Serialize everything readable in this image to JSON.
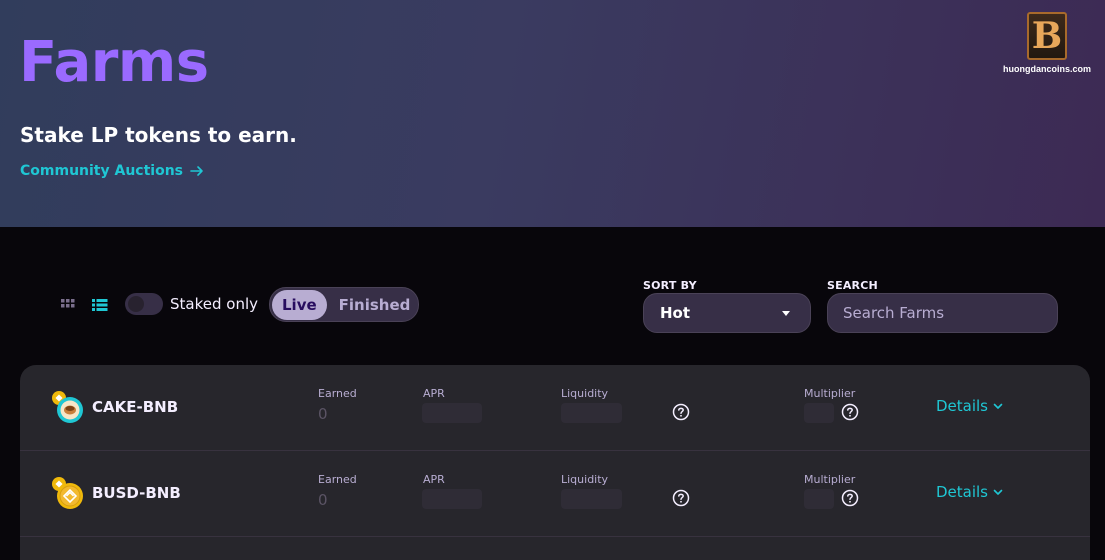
{
  "hero": {
    "title": "Farms",
    "subtitle": "Stake LP tokens to earn.",
    "link_label": "Community Auctions"
  },
  "watermark": {
    "logo_letter": "B",
    "site": "huongdancoins.com"
  },
  "controls": {
    "view_modes": [
      "grid-icon",
      "list-icon"
    ],
    "active_view": "list",
    "staked_only_label": "Staked only",
    "staked_only": false,
    "tabs": [
      {
        "label": "Live",
        "active": true
      },
      {
        "label": "Finished",
        "active": false
      }
    ],
    "sort": {
      "label": "SORT BY",
      "value": "Hot"
    },
    "search": {
      "label": "SEARCH",
      "placeholder": "Search Farms",
      "value": ""
    }
  },
  "farms": [
    {
      "name": "CAKE-BNB",
      "icon": "cake-bnb-pair-icon",
      "earned_label": "Earned",
      "earned": "0",
      "apr_label": "APR",
      "liquidity_label": "Liquidity",
      "multiplier_label": "Multiplier",
      "details_label": "Details"
    },
    {
      "name": "BUSD-BNB",
      "icon": "busd-bnb-pair-icon",
      "earned_label": "Earned",
      "earned": "0",
      "apr_label": "APR",
      "liquidity_label": "Liquidity",
      "multiplier_label": "Multiplier",
      "details_label": "Details"
    }
  ],
  "colors": {
    "accent_purple": "#9a6aff",
    "accent_teal": "#1fc7d4",
    "background": "#08060b",
    "card": "#27262c",
    "input": "#372f47"
  }
}
